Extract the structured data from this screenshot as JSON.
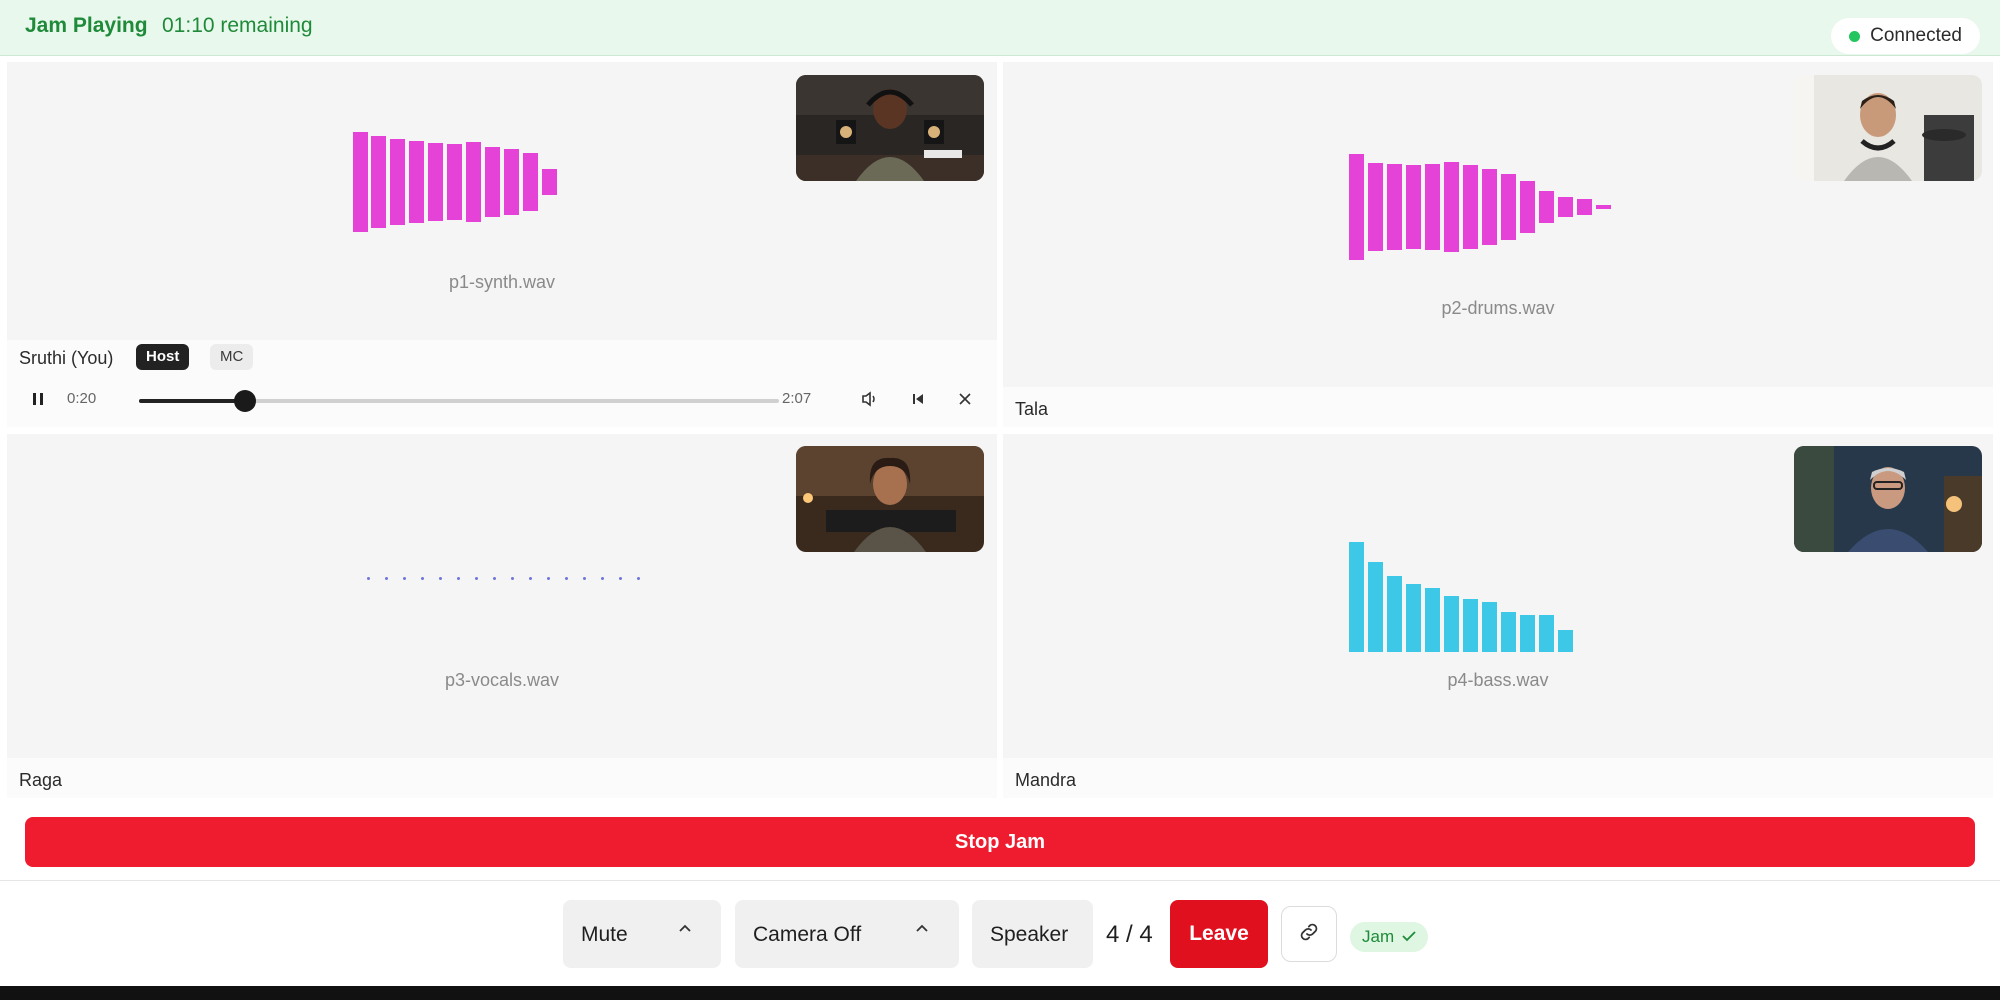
{
  "status": {
    "state": "Jam Playing",
    "remaining": "01:10 remaining",
    "connection": "Connected",
    "connection_color": "#22c55e"
  },
  "participants": [
    {
      "name": "Sruthi (You)",
      "file": "p1-synth.wav",
      "badges": [
        "Host",
        "MC"
      ],
      "waveform_color": "#e542d8",
      "player": {
        "current": "0:20",
        "duration": "2:07",
        "progress": 0.157,
        "play_icon": "pause-icon",
        "volume_icon": "volume-icon",
        "restart_icon": "skip-back-icon",
        "close_icon": "close-icon"
      }
    },
    {
      "name": "Tala",
      "file": "p2-drums.wav",
      "waveform_color": "#e542d8"
    },
    {
      "name": "Raga",
      "file": "p3-vocals.wav",
      "waveform_color": "#6f76d8"
    },
    {
      "name": "Mandra",
      "file": "p4-bass.wav",
      "waveform_color": "#3cc8e6"
    }
  ],
  "actions": {
    "stop_jam": "Stop Jam",
    "stop_color": "#ee1c2e"
  },
  "controls": {
    "mute": "Mute",
    "camera": "Camera Off",
    "speaker": "Speaker",
    "count": "4 / 4",
    "leave": "Leave",
    "link_icon": "link-icon",
    "jam": "Jam"
  }
}
